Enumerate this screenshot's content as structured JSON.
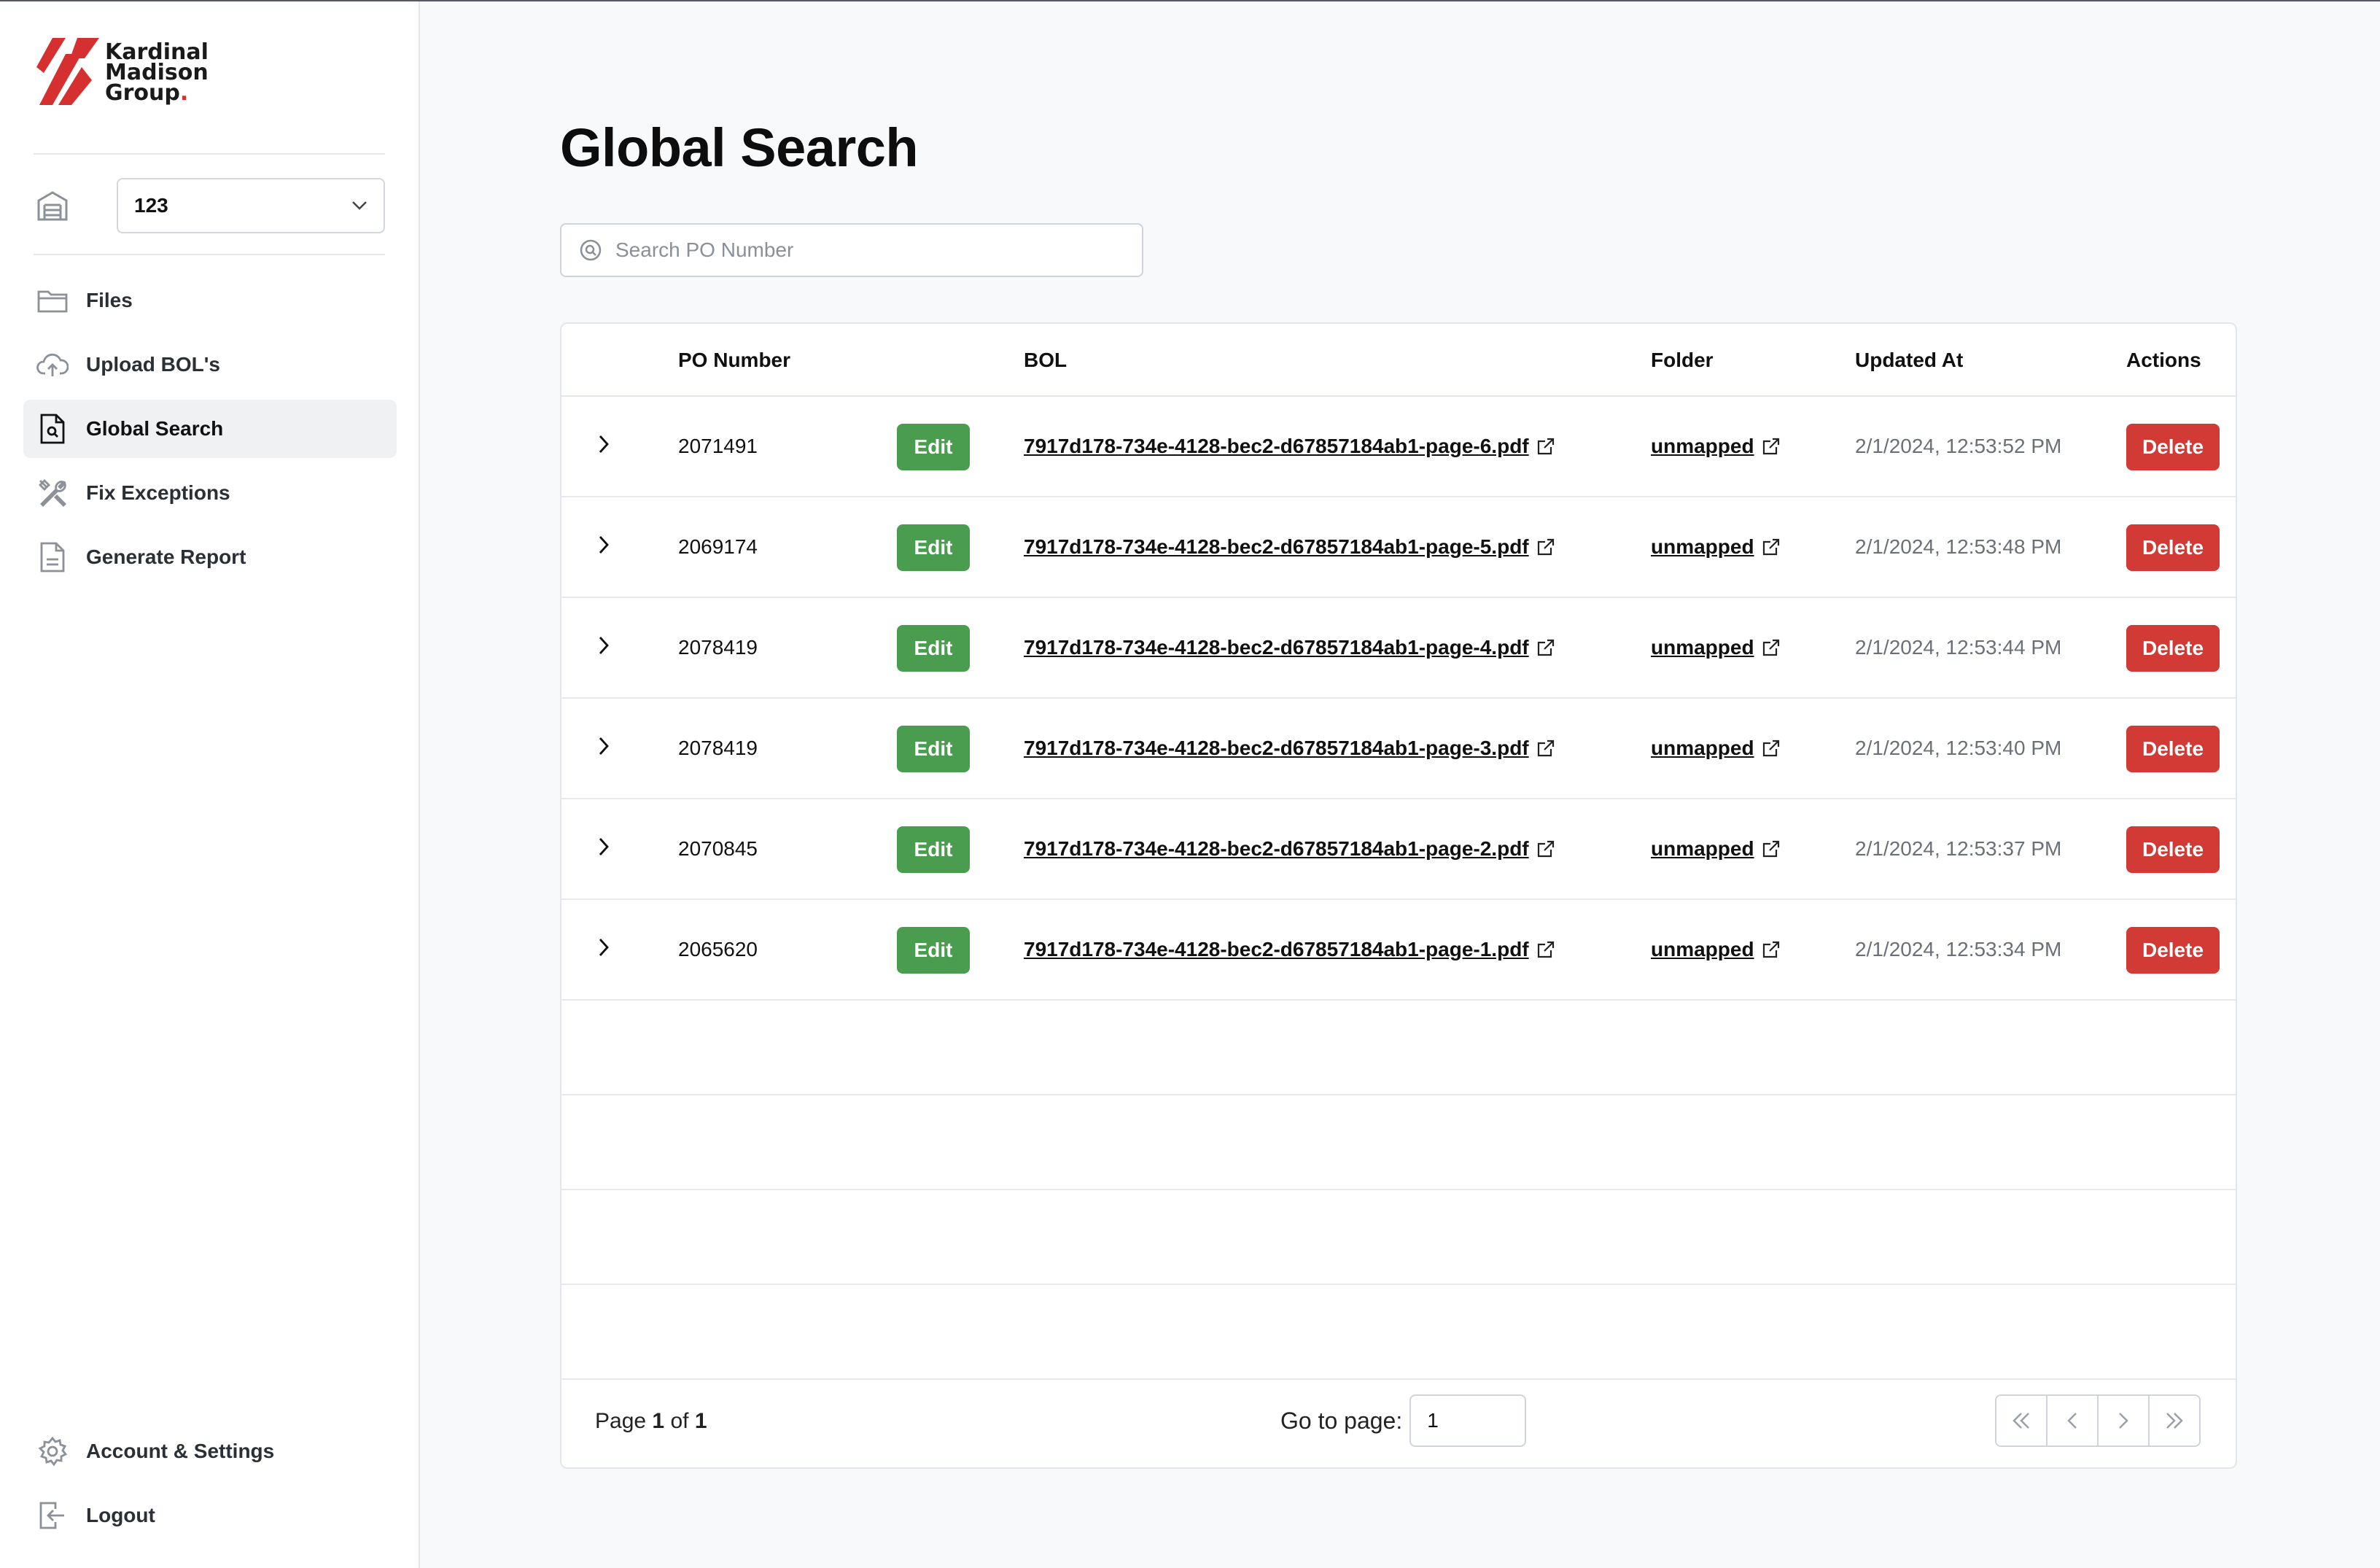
{
  "app": {
    "logo_lines": [
      "Kardinal",
      "Madison",
      "Group"
    ],
    "brand_color": "#d62f2f"
  },
  "sidebar": {
    "tenant_select": {
      "value": "123"
    },
    "items": [
      {
        "label": "Files",
        "icon": "folder-icon"
      },
      {
        "label": "Upload BOL's",
        "icon": "cloud-upload-icon"
      },
      {
        "label": "Global Search",
        "icon": "file-search-icon",
        "active": true
      },
      {
        "label": "Fix Exceptions",
        "icon": "tools-icon"
      },
      {
        "label": "Generate Report",
        "icon": "document-icon"
      }
    ],
    "bottom_items": [
      {
        "label": "Account & Settings",
        "icon": "gear-icon"
      },
      {
        "label": "Logout",
        "icon": "logout-icon"
      }
    ]
  },
  "main": {
    "title": "Global Search",
    "search": {
      "placeholder": "Search PO Number",
      "value": ""
    },
    "table": {
      "headers": {
        "po": "PO Number",
        "bol": "BOL",
        "folder": "Folder",
        "updated": "Updated At",
        "actions": "Actions"
      },
      "edit_label": "Edit",
      "delete_label": "Delete",
      "rows": [
        {
          "po": "2071491",
          "bol": "7917d178-734e-4128-bec2-d67857184ab1-page-6.pdf",
          "folder": "unmapped",
          "updated": "2/1/2024, 12:53:52 PM"
        },
        {
          "po": "2069174",
          "bol": "7917d178-734e-4128-bec2-d67857184ab1-page-5.pdf",
          "folder": "unmapped",
          "updated": "2/1/2024, 12:53:48 PM"
        },
        {
          "po": "2078419",
          "bol": "7917d178-734e-4128-bec2-d67857184ab1-page-4.pdf",
          "folder": "unmapped",
          "updated": "2/1/2024, 12:53:44 PM"
        },
        {
          "po": "2078419",
          "bol": "7917d178-734e-4128-bec2-d67857184ab1-page-3.pdf",
          "folder": "unmapped",
          "updated": "2/1/2024, 12:53:40 PM"
        },
        {
          "po": "2070845",
          "bol": "7917d178-734e-4128-bec2-d67857184ab1-page-2.pdf",
          "folder": "unmapped",
          "updated": "2/1/2024, 12:53:37 PM"
        },
        {
          "po": "2065620",
          "bol": "7917d178-734e-4128-bec2-d67857184ab1-page-1.pdf",
          "folder": "unmapped",
          "updated": "2/1/2024, 12:53:34 PM"
        }
      ],
      "empty_rows": 4
    },
    "pagination": {
      "page_label": "Page",
      "current": "1",
      "of_label": "of",
      "total": "1",
      "goto_label": "Go to page:",
      "goto_value": "1"
    },
    "colors": {
      "edit": "#4a9d4f",
      "delete": "#d23a35"
    }
  }
}
